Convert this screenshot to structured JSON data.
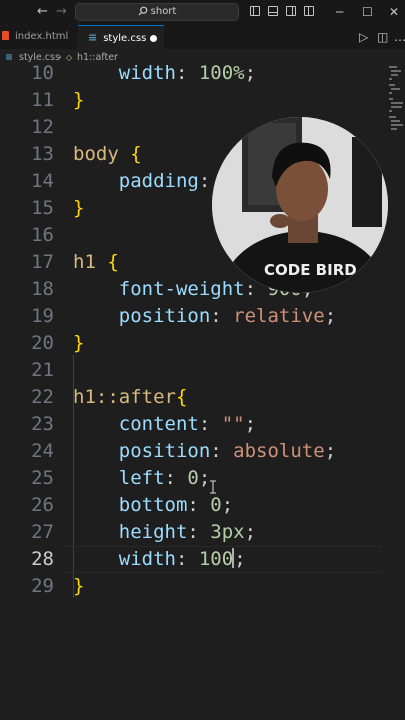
{
  "titlebar": {
    "back_icon": "arrow-left-icon",
    "forward_icon": "arrow-right-icon",
    "search_text": "short"
  },
  "tabs": [
    {
      "label": "index.html",
      "icon": "html-file-icon",
      "active": false
    },
    {
      "label": "style.css",
      "icon": "css-file-icon",
      "active": true,
      "modified": true
    }
  ],
  "breadcrumb": {
    "file": "style.css",
    "separator": "›",
    "symbol": "h1::after"
  },
  "editor": {
    "current_line": 28,
    "lines": [
      {
        "num": "10",
        "tokens": [
          [
            "    ",
            "p"
          ],
          [
            "width",
            "prop"
          ],
          [
            ": ",
            "p"
          ],
          [
            "100%",
            "num"
          ],
          [
            ";",
            "p"
          ]
        ]
      },
      {
        "num": "11",
        "tokens": [
          [
            "}",
            "brace"
          ]
        ]
      },
      {
        "num": "12",
        "tokens": []
      },
      {
        "num": "13",
        "tokens": [
          [
            "body",
            "sel"
          ],
          [
            " ",
            "p"
          ],
          [
            "{",
            "brace"
          ]
        ]
      },
      {
        "num": "14",
        "tokens": [
          [
            "    ",
            "p"
          ],
          [
            "padding",
            "prop"
          ],
          [
            ":",
            "p"
          ]
        ]
      },
      {
        "num": "15",
        "tokens": [
          [
            "}",
            "brace"
          ]
        ]
      },
      {
        "num": "16",
        "tokens": []
      },
      {
        "num": "17",
        "tokens": [
          [
            "h1",
            "sel"
          ],
          [
            " ",
            "p"
          ],
          [
            "{",
            "brace"
          ]
        ]
      },
      {
        "num": "18",
        "tokens": [
          [
            "    ",
            "p"
          ],
          [
            "font-weight",
            "prop"
          ],
          [
            ": ",
            "p"
          ],
          [
            "900",
            "num"
          ],
          [
            ";",
            "p"
          ]
        ]
      },
      {
        "num": "19",
        "tokens": [
          [
            "    ",
            "p"
          ],
          [
            "position",
            "prop"
          ],
          [
            ": ",
            "p"
          ],
          [
            "relative",
            "val"
          ],
          [
            ";",
            "p"
          ]
        ]
      },
      {
        "num": "20",
        "tokens": [
          [
            "}",
            "brace"
          ]
        ]
      },
      {
        "num": "21",
        "tokens": []
      },
      {
        "num": "22",
        "tokens": [
          [
            "h1::after",
            "sel"
          ],
          [
            "{",
            "brace"
          ]
        ]
      },
      {
        "num": "23",
        "tokens": [
          [
            "    ",
            "p"
          ],
          [
            "content",
            "prop"
          ],
          [
            ": ",
            "p"
          ],
          [
            "\"\"",
            "str"
          ],
          [
            ";",
            "p"
          ]
        ]
      },
      {
        "num": "24",
        "tokens": [
          [
            "    ",
            "p"
          ],
          [
            "position",
            "prop"
          ],
          [
            ": ",
            "p"
          ],
          [
            "absolute",
            "val"
          ],
          [
            ";",
            "p"
          ]
        ]
      },
      {
        "num": "25",
        "tokens": [
          [
            "    ",
            "p"
          ],
          [
            "left",
            "prop"
          ],
          [
            ": ",
            "p"
          ],
          [
            "0",
            "num"
          ],
          [
            ";",
            "p"
          ]
        ]
      },
      {
        "num": "26",
        "tokens": [
          [
            "    ",
            "p"
          ],
          [
            "bottom",
            "prop"
          ],
          [
            ": ",
            "p"
          ],
          [
            "0",
            "num"
          ],
          [
            ";",
            "p"
          ]
        ]
      },
      {
        "num": "27",
        "tokens": [
          [
            "    ",
            "p"
          ],
          [
            "height",
            "prop"
          ],
          [
            ": ",
            "p"
          ],
          [
            "3px",
            "num"
          ],
          [
            ";",
            "p"
          ]
        ]
      },
      {
        "num": "28",
        "tokens": [
          [
            "    ",
            "p"
          ],
          [
            "width",
            "prop"
          ],
          [
            ": ",
            "p"
          ],
          [
            "100",
            "num"
          ],
          [
            "|",
            "cursor"
          ],
          [
            ";",
            "p"
          ]
        ]
      },
      {
        "num": "29",
        "tokens": [
          [
            "}",
            "brace"
          ]
        ]
      }
    ]
  },
  "webcam": {
    "icon": "webcam-person-overlay",
    "shirt_text": "CODE BIRD"
  },
  "colors": {
    "background": "#1e1e1e",
    "selector": "#d7ba7d",
    "property": "#9cdcfe",
    "number": "#b5cea8",
    "string": "#ce9178",
    "brace": "#ffd700",
    "line_number": "#6e7681"
  }
}
